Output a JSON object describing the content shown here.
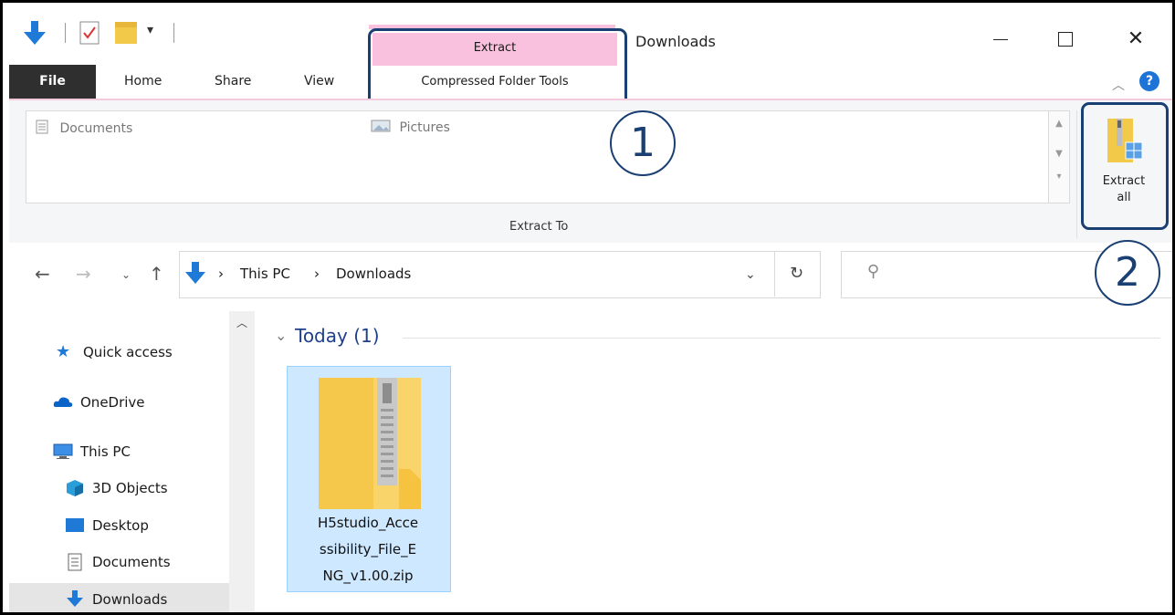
{
  "window": {
    "title": "Downloads",
    "controls": {
      "minimize": "—",
      "maximize": "☐",
      "close": "✕"
    }
  },
  "quick_access_toolbar": [
    "down-arrow-icon",
    "properties-check-icon",
    "folder-icon",
    "customize-dropdown-icon"
  ],
  "contextual_tab": {
    "group_label": "Extract",
    "name": "Compressed Folder Tools",
    "color": "#f9c1dd"
  },
  "ribbon": {
    "tabs": [
      "File",
      "Home",
      "Share",
      "View"
    ],
    "gallery": [
      "Documents",
      "Pictures"
    ],
    "group_label": "Extract To",
    "extract_all_label_line1": "Extract",
    "extract_all_label_line2": "all"
  },
  "annotations": {
    "step1": "1",
    "step2": "2",
    "color": "#1a3f73"
  },
  "address_bar": {
    "breadcrumbs": [
      "This PC",
      "Downloads"
    ],
    "separator": "›",
    "search_placeholder": ""
  },
  "navigation": {
    "items": [
      {
        "label": "Quick access",
        "icon": "star-icon"
      },
      {
        "label": "OneDrive",
        "icon": "cloud-icon"
      },
      {
        "label": "This PC",
        "icon": "computer-icon"
      },
      {
        "label": "3D Objects",
        "icon": "cube-icon"
      },
      {
        "label": "Desktop",
        "icon": "desktop-icon"
      },
      {
        "label": "Documents",
        "icon": "document-icon"
      },
      {
        "label": "Downloads",
        "icon": "download-icon",
        "selected": true
      }
    ]
  },
  "content": {
    "group_header": "Today (1)",
    "files": [
      {
        "name": "H5studio_Accessibility_File_ENG_v1.00.zip",
        "display_lines": [
          "H5studio_Acce",
          "ssibility_File_E",
          "NG_v1.00.zip"
        ],
        "selected": true
      }
    ]
  }
}
